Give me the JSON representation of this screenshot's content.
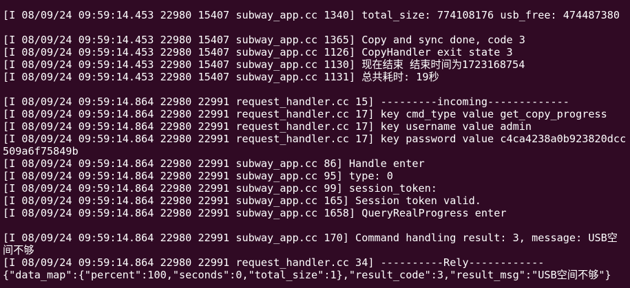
{
  "terminal": {
    "lines": [
      "[I 08/09/24 09:59:14.453 22980 15407 subway_app.cc 1340] total_size: 774108176 usb_free: 474487380",
      "",
      "[I 08/09/24 09:59:14.453 22980 15407 subway_app.cc 1365] Copy and sync done, code 3",
      "[I 08/09/24 09:59:14.453 22980 15407 subway_app.cc 1126] CopyHandler exit state 3",
      "[I 08/09/24 09:59:14.453 22980 15407 subway_app.cc 1130] 现在结束 结束时间为1723168754",
      "[I 08/09/24 09:59:14.453 22980 15407 subway_app.cc 1131] 总共耗时: 19秒",
      "",
      "[I 08/09/24 09:59:14.864 22980 22991 request_handler.cc 15] ---------incoming-------------",
      "[I 08/09/24 09:59:14.864 22980 22991 request_handler.cc 17] key cmd_type value get_copy_progress",
      "[I 08/09/24 09:59:14.864 22980 22991 request_handler.cc 17] key username value admin",
      "[I 08/09/24 09:59:14.864 22980 22991 request_handler.cc 17] key password value c4ca4238a0b923820dcc509a6f75849b",
      "[I 08/09/24 09:59:14.864 22980 22991 subway_app.cc 86] Handle enter",
      "[I 08/09/24 09:59:14.864 22980 22991 subway_app.cc 95] type: 0",
      "[I 08/09/24 09:59:14.864 22980 22991 subway_app.cc 99] session_token:",
      "[I 08/09/24 09:59:14.864 22980 22991 subway_app.cc 165] Session token valid.",
      "[I 08/09/24 09:59:14.864 22980 22991 subway_app.cc 1658] QueryRealProgress enter",
      "",
      "[I 08/09/24 09:59:14.864 22980 22991 subway_app.cc 170] Command handling result: 3, message: USB空间不够",
      "[I 08/09/24 09:59:14.864 22980 22991 request_handler.cc 34] ----------Rely------------",
      "{\"data_map\":{\"percent\":100,\"seconds\":0,\"total_size\":1},\"result_code\":3,\"result_msg\":\"USB空间不够\"}"
    ]
  }
}
